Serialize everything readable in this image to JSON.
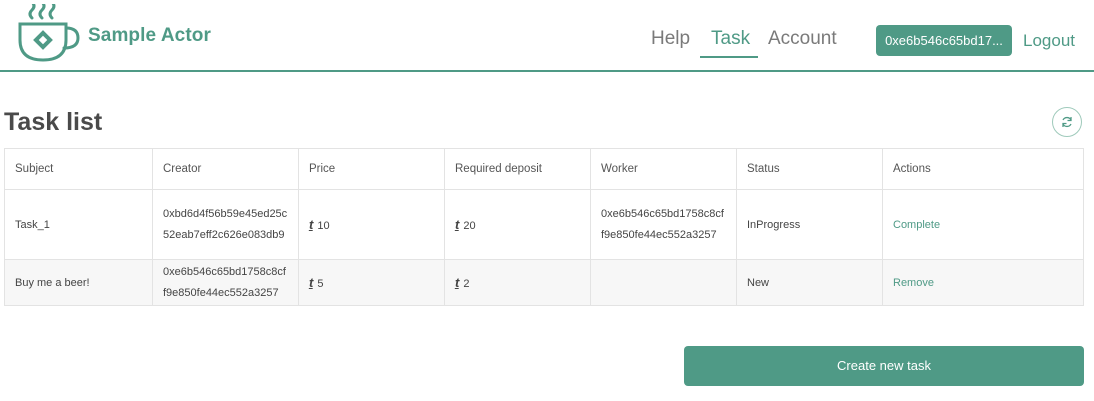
{
  "header": {
    "brand": "Sample Actor",
    "nav": [
      {
        "label": "Help"
      },
      {
        "label": "Task",
        "active": true
      },
      {
        "label": "Account"
      }
    ],
    "account_address": "0xe6b546c65bd17...",
    "logout_label": "Logout",
    "accent_color": "#4f9a86"
  },
  "page": {
    "title": "Task list",
    "refresh_icon": "refresh-icon"
  },
  "table": {
    "columns": [
      "Subject",
      "Creator",
      "Price",
      "Required deposit",
      "Worker",
      "Status",
      "Actions"
    ],
    "currency_symbol": "ṯ",
    "rows": [
      {
        "subject": "Task_1",
        "creator": "0xbd6d4f56b59e45ed25c52eab7eff2c626e083db9",
        "price": "10",
        "deposit": "20",
        "worker": "0xe6b546c65bd1758c8cff9e850fe44ec552a3257",
        "status": "InProgress",
        "action": "Complete"
      },
      {
        "subject": "Buy me a beer!",
        "creator": "0xe6b546c65bd1758c8cff9e850fe44ec552a3257",
        "price": "5",
        "deposit": "2",
        "worker": "",
        "status": "New",
        "action": "Remove"
      }
    ]
  },
  "create_button_label": "Create new task"
}
